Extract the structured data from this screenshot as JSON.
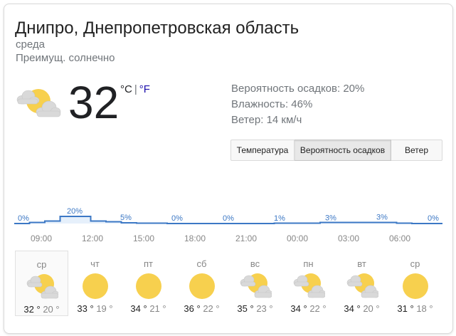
{
  "location": "Днипро, Днепропетровская область",
  "day_label": "среда",
  "condition": "Преимущ. солнечно",
  "current": {
    "temperature": "32",
    "icon": "partly-cloudy-icon",
    "unit_c": "°C",
    "unit_sep": "|",
    "unit_f": "°F"
  },
  "details": {
    "precipitation": "Вероятность осадков: 20%",
    "humidity": "Влажность: 46%",
    "wind": "Ветер: 14 км/ч"
  },
  "tabs": [
    {
      "label": "Температура",
      "active": false
    },
    {
      "label": "Вероятность осадков",
      "active": true
    },
    {
      "label": "Ветер",
      "active": false
    }
  ],
  "precip_chart": {
    "labels": [
      "0%",
      "20%",
      "5%",
      "0%",
      "0%",
      "1%",
      "3%",
      "3%",
      "0%"
    ],
    "values": [
      0,
      3,
      7,
      20,
      20,
      7,
      5,
      2,
      1,
      1,
      0,
      0,
      0,
      0,
      0,
      0,
      0,
      1,
      1,
      1,
      3,
      3,
      3,
      3,
      3,
      1,
      0,
      0
    ],
    "times": [
      "09:00",
      "12:00",
      "15:00",
      "18:00",
      "21:00",
      "00:00",
      "03:00",
      "06:00"
    ],
    "line_color": "#3c78c5",
    "fill_color": "#e6f0fb"
  },
  "forecast": [
    {
      "day": "ср",
      "icon": "partly-cloudy-icon",
      "hi": "32 °",
      "lo": "20 °",
      "selected": true
    },
    {
      "day": "чт",
      "icon": "sun-icon",
      "hi": "33 °",
      "lo": "19 °"
    },
    {
      "day": "пт",
      "icon": "sun-icon",
      "hi": "34 °",
      "lo": "21 °"
    },
    {
      "day": "сб",
      "icon": "sun-icon",
      "hi": "36 °",
      "lo": "22 °"
    },
    {
      "day": "вс",
      "icon": "partly-cloudy-icon",
      "hi": "35 °",
      "lo": "23 °"
    },
    {
      "day": "пн",
      "icon": "partly-cloudy-icon",
      "hi": "34 °",
      "lo": "22 °"
    },
    {
      "day": "вт",
      "icon": "partly-cloudy-icon",
      "hi": "34 °",
      "lo": "20 °"
    },
    {
      "day": "ср",
      "icon": "sun-icon",
      "hi": "31 °",
      "lo": "18 °"
    }
  ]
}
